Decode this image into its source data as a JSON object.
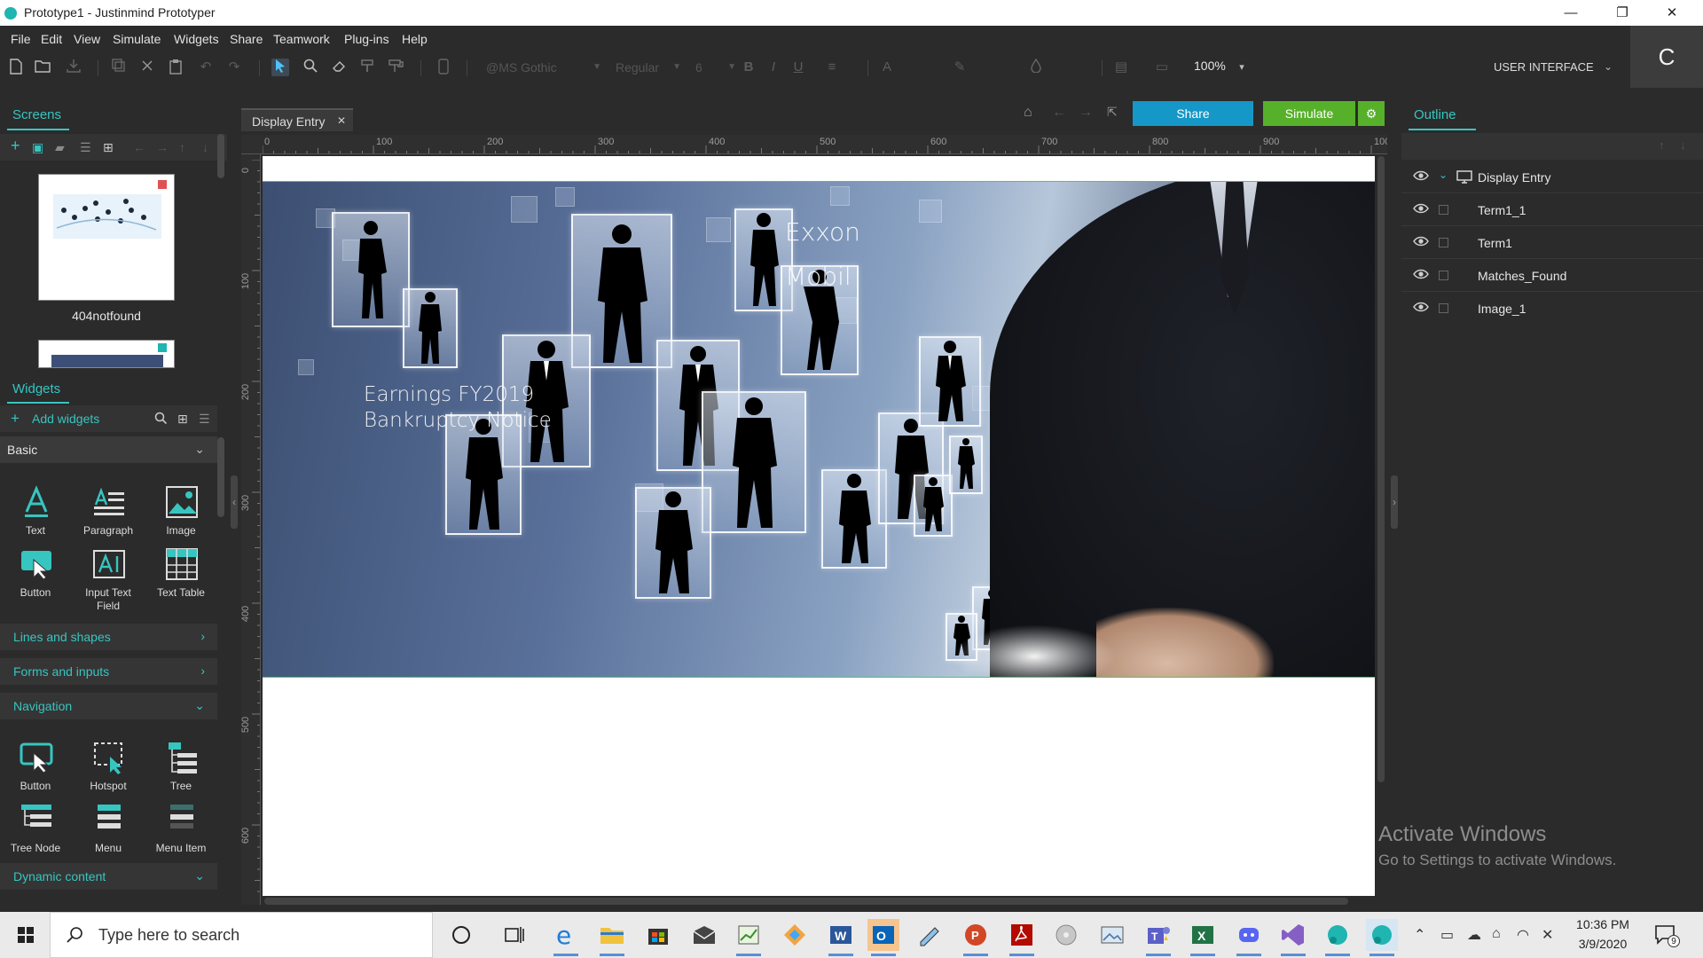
{
  "window": {
    "title": "Prototype1 - Justinmind Prototyper",
    "minimize_glyph": "—",
    "restore_glyph": "❐",
    "close_glyph": "✕"
  },
  "menu": [
    "File",
    "Edit",
    "View",
    "Simulate",
    "Widgets",
    "Share",
    "Teamwork",
    "Plug-ins",
    "Help"
  ],
  "toolbar": {
    "font_family": "@MS Gothic",
    "font_style": "Regular",
    "font_size": "6",
    "zoom": "100%",
    "perspective": "USER INTERFACE",
    "user_initial": "C"
  },
  "screens_panel": {
    "title": "Screens",
    "screens": [
      {
        "name": "404notfound"
      },
      {
        "name": ""
      }
    ]
  },
  "widgets_panel": {
    "title": "Widgets",
    "add_label": "Add widgets",
    "category_selected": "Basic",
    "basic": [
      "Text",
      "Paragraph",
      "Image",
      "Button",
      "Input Text Field",
      "Text Table"
    ],
    "sections": [
      "Lines and shapes",
      "Forms and inputs",
      "Navigation",
      "Dynamic content"
    ],
    "navigation": [
      "Button",
      "Hotspot",
      "Tree",
      "Tree Node",
      "Menu",
      "Menu Item"
    ]
  },
  "editor": {
    "tab_label": "Display Entry",
    "share_label": "Share",
    "simulate_label": "Simulate",
    "ruler_top": [
      "0",
      "100",
      "200",
      "300",
      "400",
      "500",
      "600",
      "700",
      "800",
      "900",
      "100"
    ],
    "ruler_left": [
      "0",
      "100",
      "200",
      "300",
      "400",
      "500",
      "600"
    ],
    "hero_text": {
      "line1": "Earnings FY2019",
      "line2": "Bankruptcy Notice",
      "company1": "Exxon",
      "company2": "Mobil"
    }
  },
  "outline_panel": {
    "title": "Outline",
    "items": [
      {
        "label": "Display Entry"
      },
      {
        "label": "Term1_1"
      },
      {
        "label": "Term1"
      },
      {
        "label": "Matches_Found"
      },
      {
        "label": "Image_1"
      }
    ]
  },
  "watermark": {
    "line1": "Activate Windows",
    "line2": "Go to Settings to activate Windows."
  },
  "taskbar": {
    "search_placeholder": "Type here to search",
    "time": "10:36 PM",
    "date": "3/9/2020",
    "notification_count": "9"
  },
  "colors": {
    "accent": "#37c5c0",
    "share": "#1597c7",
    "simulate": "#57b02a",
    "selection_border": "#38d26a"
  }
}
